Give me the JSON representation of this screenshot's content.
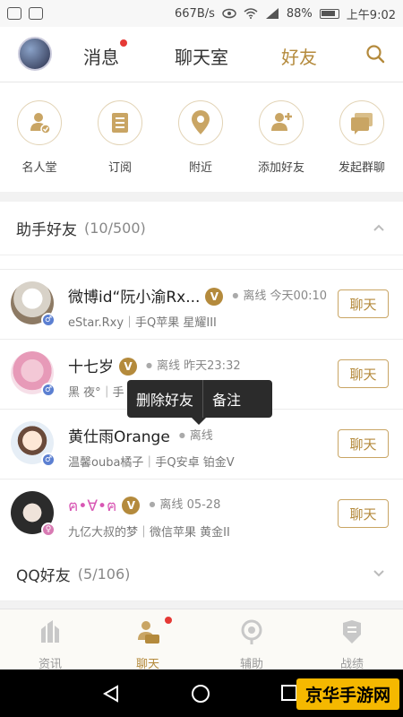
{
  "status_bar": {
    "speed": "667B/s",
    "battery": "88%",
    "time": "上午9:02"
  },
  "top_nav": {
    "tabs": [
      {
        "label": "消息",
        "has_badge": true
      },
      {
        "label": "聊天室"
      },
      {
        "label": "好友",
        "active": true
      }
    ],
    "search_icon": "search-icon"
  },
  "quick_actions": [
    {
      "label": "名人堂",
      "icon": "hall-of-fame-icon"
    },
    {
      "label": "订阅",
      "icon": "subscribe-icon"
    },
    {
      "label": "附近",
      "icon": "location-pin-icon"
    },
    {
      "label": "添加好友",
      "icon": "add-friend-icon"
    },
    {
      "label": "发起群聊",
      "icon": "group-chat-icon"
    }
  ],
  "helper_friends": {
    "title": "助手好友",
    "count": "(10/500)",
    "rows": [
      {
        "name": "微博id“阮小渝Rx...",
        "vip": "V",
        "status": "离线",
        "time": "今天00:10",
        "sub": "eStar.Rxy｜手Q苹果 星耀III",
        "gender": "♂",
        "button": "聊天"
      },
      {
        "name": "十七岁",
        "vip": "V",
        "status": "离线",
        "time": "昨天23:32",
        "sub": "黑 夜°｜手",
        "gender": "♂",
        "button": "聊天"
      },
      {
        "name": "黄仕雨Orange",
        "vip": "",
        "status": "离线",
        "time": "",
        "sub": "温馨ouba橘子｜手Q安卓 铂金V",
        "gender": "♂",
        "button": "聊天"
      },
      {
        "name": "ฅ•∀•ฅ",
        "vip": "V",
        "status": "离线",
        "time": "05-28",
        "sub": "九亿大叔的梦｜微信苹果 黄金II",
        "gender": "♀",
        "button": "聊天"
      }
    ]
  },
  "context_menu": {
    "delete": "删除好友",
    "remark": "备注"
  },
  "qq_friends": {
    "title": "QQ好友",
    "count": "(5/106)"
  },
  "bottom_tabs": [
    {
      "label": "资讯",
      "icon": "news-icon"
    },
    {
      "label": "聊天",
      "icon": "chat-icon",
      "active": true,
      "has_badge": true
    },
    {
      "label": "辅助",
      "icon": "assist-icon"
    },
    {
      "label": "战绩",
      "icon": "record-icon"
    }
  ],
  "watermark": "京华手游网",
  "colors": {
    "accent": "#b48a3c",
    "badge_red": "#e53935"
  }
}
